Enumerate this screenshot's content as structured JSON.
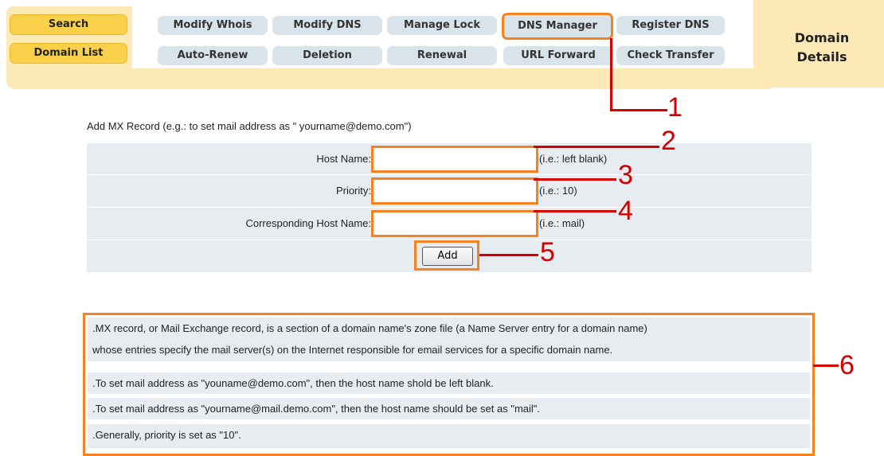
{
  "nav": {
    "search": "Search",
    "domain_list": "Domain List",
    "tabs_row1": [
      "Modify Whois",
      "Modify DNS",
      "Manage Lock",
      "DNS Manager",
      "Register DNS"
    ],
    "tabs_row2": [
      "Auto-Renew",
      "Deletion",
      "Renewal",
      "URL Forward",
      "Check Transfer"
    ],
    "active_tab": "DNS Manager",
    "details_line1": "Domain",
    "details_line2": "Details"
  },
  "callouts": [
    "1",
    "2",
    "3",
    "4",
    "5",
    "6"
  ],
  "form": {
    "caption": "Add MX Record (e.g.: to set mail address as \" yourname@demo.com\")",
    "rows": [
      {
        "label": "Host Name:",
        "value": "",
        "hint": "(i.e.: left blank)"
      },
      {
        "label": "Priority:",
        "value": "",
        "hint": "(i.e.: 10)"
      },
      {
        "label": "Corresponding Host Name:",
        "value": "",
        "hint": "(i.e.: mail)"
      }
    ],
    "add_label": "Add"
  },
  "info": [
    ".MX record, or Mail Exchange record, is a section of a domain name's zone file (a Name Server entry for a domain name)",
    "whose entries specify the mail server(s) on the Internet responsible for email services for a specific domain name.",
    ".To set mail address as \"youname@demo.com\", then the host name shold be left blank.",
    ".To set mail address as \"yourname@mail.demo.com\", then the host name should be set as \"mail\".",
    ".Generally, priority is set as \"10\"."
  ],
  "colors": {
    "accent_orange": "#f58220",
    "callout_red": "#d40000",
    "nav_yellow": "#f9d04a",
    "panel_cream": "#fde9b6",
    "tab_blue_gray": "#d9e3ea",
    "row_bg": "#e7ecf1"
  }
}
